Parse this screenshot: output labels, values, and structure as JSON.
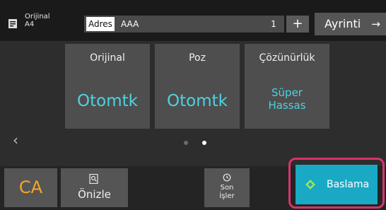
{
  "topbar": {
    "original_label": "Orijinal",
    "original_size": "A4",
    "address_label": "Adres",
    "address_value": "AAA",
    "copies": "1",
    "plus_label": "+",
    "detail_label": "Ayrinti",
    "detail_arrow": "→"
  },
  "cards": [
    {
      "title": "Orijinal",
      "value": "Otomtk"
    },
    {
      "title": "Poz",
      "value": "Otomtk"
    },
    {
      "title": "Çözünürlük",
      "value_line1": "Süper",
      "value_line2": "Hassas"
    }
  ],
  "pager": {
    "prev": "‹",
    "pages": 2,
    "current": 2
  },
  "bottombar": {
    "ca_label": "CA",
    "preview_label": "Önizle",
    "recent_line1": "Son",
    "recent_line2": "İşler",
    "start_label": "Baslama"
  },
  "colors": {
    "accent_value": "#4fd1e0",
    "start_button": "#1aa9c4",
    "ca_text": "#f5a623",
    "highlight": "#d9336a"
  }
}
